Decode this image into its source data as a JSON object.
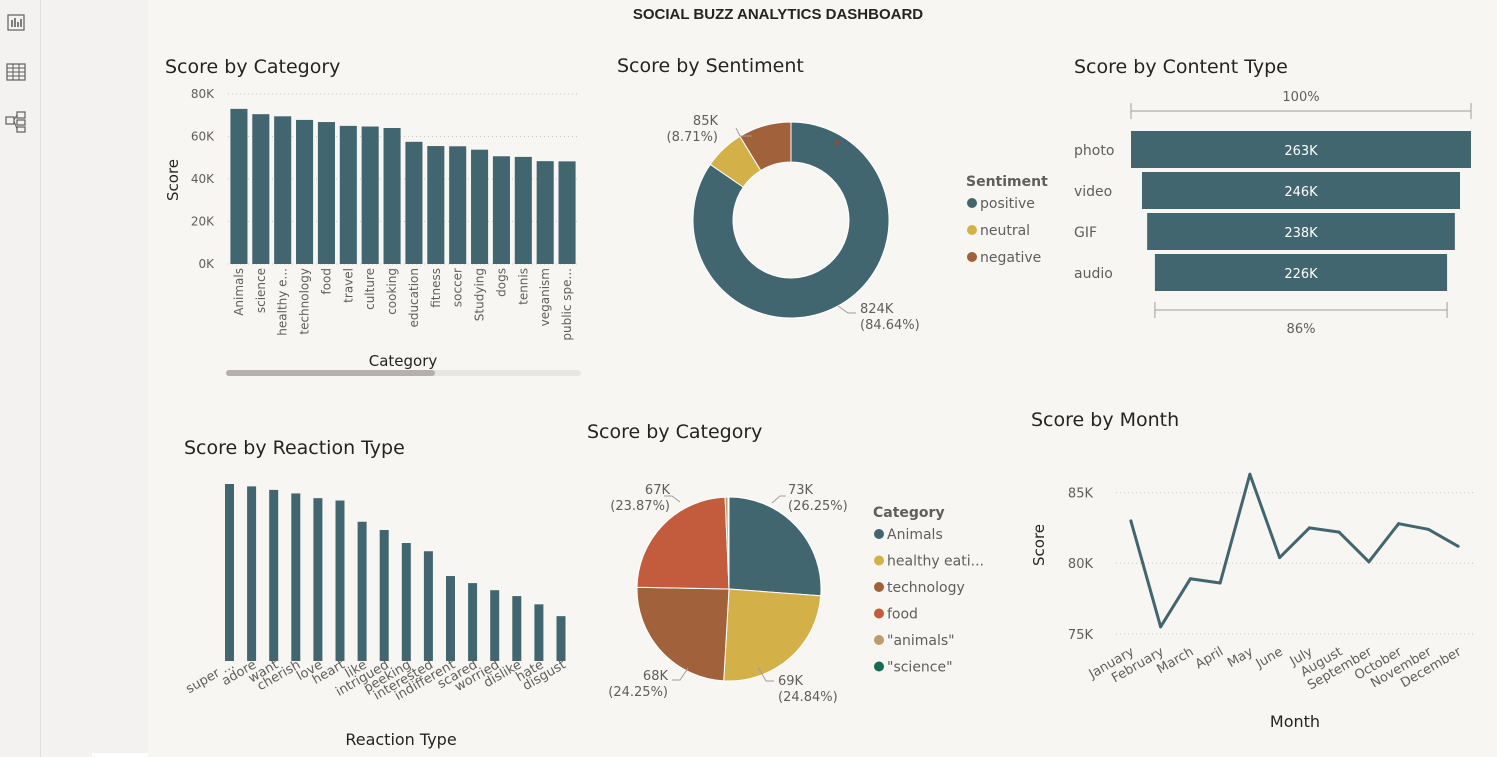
{
  "dashboard_title": "SOCIAL BUZZ ANALYTICS DASHBOARD",
  "left_nav": {
    "icons": [
      "report-view-icon",
      "data-view-icon",
      "model-view-icon"
    ]
  },
  "colors": {
    "teal": "#41666f",
    "gold": "#d4b049",
    "brown": "#a0613b",
    "orange_red": "#c35c3c",
    "tan": "#c19a6b",
    "green": "#136d53",
    "background": "#f7f6f2"
  },
  "panels": {
    "category_bar": {
      "title": "Score by Category"
    },
    "sentiment": {
      "title": "Score by Sentiment"
    },
    "content_type": {
      "title": "Score by Content Type"
    },
    "reaction": {
      "title": "Score by Reaction Type"
    },
    "category_pie": {
      "title": "Score by Category"
    },
    "month": {
      "title": "Score by Month"
    }
  },
  "chart_data": [
    {
      "id": "category_bar",
      "type": "bar",
      "title": "Score by Category",
      "xlabel": "Category",
      "ylabel": "Score",
      "ylim": [
        0,
        80000
      ],
      "yticks": [
        "0K",
        "20K",
        "40K",
        "60K",
        "80K"
      ],
      "categories": [
        "Animals",
        "science",
        "healthy e...",
        "technology",
        "food",
        "travel",
        "culture",
        "cooking",
        "education",
        "fitness",
        "soccer",
        "Studying",
        "dogs",
        "tennis",
        "veganism",
        "public spe..."
      ],
      "values": [
        73000,
        70500,
        69500,
        67800,
        66800,
        65000,
        64700,
        64000,
        57500,
        55500,
        55400,
        53800,
        50700,
        50400,
        48400,
        48300
      ],
      "grid": true,
      "scrollbar": true
    },
    {
      "id": "sentiment",
      "type": "pie",
      "title": "Score by Sentiment",
      "donut": true,
      "legend_title": "Sentiment",
      "legend_position": "right",
      "slices": [
        {
          "label": "positive",
          "value": 824000,
          "display": "824K",
          "percent": "(84.64%)",
          "color": "#41666f"
        },
        {
          "label": "neutral",
          "value": 65000,
          "display": "",
          "percent": "",
          "color": "#d4b049"
        },
        {
          "label": "negative",
          "value": 85000,
          "display": "85K",
          "percent": "(8.71%)",
          "color": "#a0613b"
        }
      ]
    },
    {
      "id": "content_type",
      "type": "bar",
      "subtype": "funnel",
      "title": "Score by Content Type",
      "categories": [
        "photo",
        "video",
        "GIF",
        "audio"
      ],
      "values": [
        263000,
        246000,
        238000,
        226000
      ],
      "value_labels": [
        "263K",
        "246K",
        "238K",
        "226K"
      ],
      "top_percent": "100%",
      "bottom_percent": "86%"
    },
    {
      "id": "reaction",
      "type": "bar",
      "title": "Score by Reaction Type",
      "xlabel": "Reaction Type",
      "categories": [
        "super ...",
        "adore",
        "want",
        "cherish",
        "love",
        "heart",
        "like",
        "intrigued",
        "peeking",
        "interested",
        "indifferent",
        "scared",
        "worried",
        "dislike",
        "hate",
        "disgust"
      ],
      "values": [
        75000,
        74000,
        72500,
        71000,
        69000,
        68000,
        59000,
        55500,
        50000,
        46500,
        36000,
        33000,
        30000,
        27500,
        24000,
        19000
      ],
      "value_axis": false
    },
    {
      "id": "category_pie",
      "type": "pie",
      "title": "Score by Category",
      "legend_title": "Category",
      "legend_position": "right",
      "slices": [
        {
          "label": "Animals",
          "value": 73000,
          "display": "73K",
          "percent": "(26.25%)",
          "color": "#41666f"
        },
        {
          "label": "healthy eati...",
          "value": 69000,
          "display": "69K",
          "percent": "(24.84%)",
          "color": "#d4b049"
        },
        {
          "label": "technology",
          "value": 68000,
          "display": "68K",
          "percent": "(24.25%)",
          "color": "#a0613b"
        },
        {
          "label": "food",
          "value": 67000,
          "display": "67K",
          "percent": "(23.87%)",
          "color": "#c35c3c"
        },
        {
          "label": "\"animals\"",
          "value": 1400,
          "display": "",
          "percent": "",
          "color": "#c19a6b"
        },
        {
          "label": "\"science\"",
          "value": 500,
          "display": "",
          "percent": "",
          "color": "#136d53"
        }
      ]
    },
    {
      "id": "month",
      "type": "line",
      "title": "Score by Month",
      "xlabel": "Month",
      "ylabel": "Score",
      "ylim": [
        74000,
        86600
      ],
      "yticks": [
        {
          "value": 75000,
          "label": "75K"
        },
        {
          "value": 80000,
          "label": "80K"
        },
        {
          "value": 85000,
          "label": "85K"
        }
      ],
      "x": [
        "January",
        "February",
        "March",
        "April",
        "May",
        "June",
        "July",
        "August",
        "September",
        "October",
        "November",
        "December"
      ],
      "values": [
        83000,
        75500,
        78900,
        78600,
        86300,
        80400,
        82500,
        82200,
        80100,
        82800,
        82400,
        81200
      ],
      "grid": true
    }
  ]
}
